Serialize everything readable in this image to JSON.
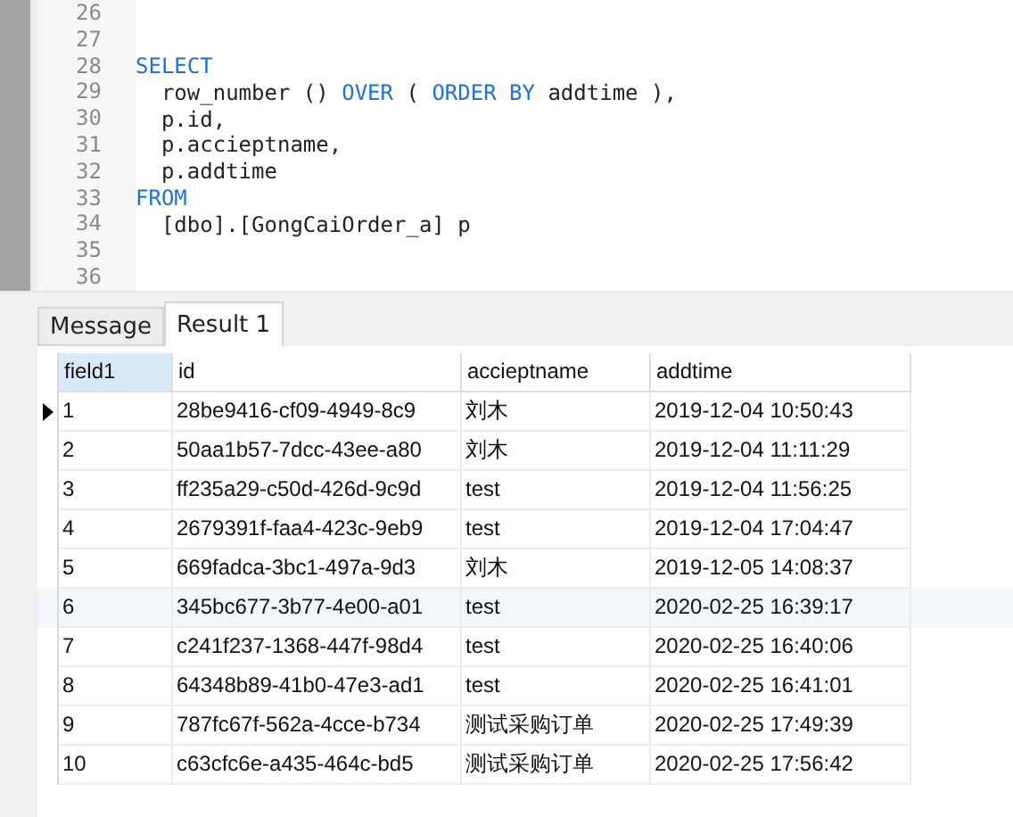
{
  "editor": {
    "lines": [
      {
        "number": "26"
      },
      {
        "number": "27"
      },
      {
        "number": "28",
        "segments": [
          {
            "text": "SELECT",
            "kind": "keyword"
          }
        ]
      },
      {
        "number": "29",
        "segments": [
          {
            "text": "  row_number () ",
            "kind": "plain"
          },
          {
            "text": "OVER",
            "kind": "keyword"
          },
          {
            "text": " ( ",
            "kind": "plain"
          },
          {
            "text": "ORDER BY",
            "kind": "keyword"
          },
          {
            "text": " addtime ),",
            "kind": "plain"
          }
        ]
      },
      {
        "number": "30",
        "segments": [
          {
            "text": "  p.id,",
            "kind": "plain"
          }
        ]
      },
      {
        "number": "31",
        "segments": [
          {
            "text": "  p.accieptname,",
            "kind": "plain"
          }
        ]
      },
      {
        "number": "32",
        "segments": [
          {
            "text": "  p.addtime",
            "kind": "plain"
          }
        ]
      },
      {
        "number": "33",
        "segments": [
          {
            "text": "FROM",
            "kind": "keyword"
          }
        ]
      },
      {
        "number": "34",
        "segments": [
          {
            "text": "  [dbo].[GongCaiOrder_a] p",
            "kind": "plain"
          }
        ]
      },
      {
        "number": "35"
      },
      {
        "number": "36"
      }
    ]
  },
  "tabs": [
    {
      "label": "Message",
      "selected": false
    },
    {
      "label": "Result 1",
      "selected": true
    }
  ],
  "table": {
    "columns": [
      {
        "label": "field1",
        "selected": true
      },
      {
        "label": "id",
        "selected": false
      },
      {
        "label": "accieptname",
        "selected": false
      },
      {
        "label": "addtime",
        "selected": false
      }
    ],
    "rows": [
      {
        "selected": true,
        "highlighted": false,
        "cells": [
          "1",
          "28be9416-cf09-4949-8c9",
          "刘木",
          "2019-12-04 10:50:43"
        ]
      },
      {
        "selected": false,
        "highlighted": false,
        "cells": [
          "2",
          "50aa1b57-7dcc-43ee-a80",
          "刘木",
          "2019-12-04 11:11:29"
        ]
      },
      {
        "selected": false,
        "highlighted": false,
        "cells": [
          "3",
          "ff235a29-c50d-426d-9c9d",
          "test",
          "2019-12-04 11:56:25"
        ]
      },
      {
        "selected": false,
        "highlighted": false,
        "cells": [
          "4",
          "2679391f-faa4-423c-9eb9",
          "test",
          "2019-12-04 17:04:47"
        ]
      },
      {
        "selected": false,
        "highlighted": false,
        "cells": [
          "5",
          "669fadca-3bc1-497a-9d3",
          "刘木",
          "2019-12-05 14:08:37"
        ]
      },
      {
        "selected": false,
        "highlighted": true,
        "cells": [
          "6",
          "345bc677-3b77-4e00-a01",
          "test",
          "2020-02-25 16:39:17"
        ]
      },
      {
        "selected": false,
        "highlighted": false,
        "cells": [
          "7",
          "c241f237-1368-447f-98d4",
          "test",
          "2020-02-25 16:40:06"
        ]
      },
      {
        "selected": false,
        "highlighted": false,
        "cells": [
          "8",
          "64348b89-41b0-47e3-ad1",
          "test",
          "2020-02-25 16:41:01"
        ]
      },
      {
        "selected": false,
        "highlighted": false,
        "cells": [
          "9",
          "787fc67f-562a-4cce-b734",
          "测试采购订单",
          "2020-02-25 17:49:39"
        ]
      },
      {
        "selected": false,
        "highlighted": false,
        "cells": [
          "10",
          "c63cfc6e-a435-464c-bd5",
          "测试采购订单",
          "2020-02-25 17:56:42"
        ]
      }
    ]
  }
}
